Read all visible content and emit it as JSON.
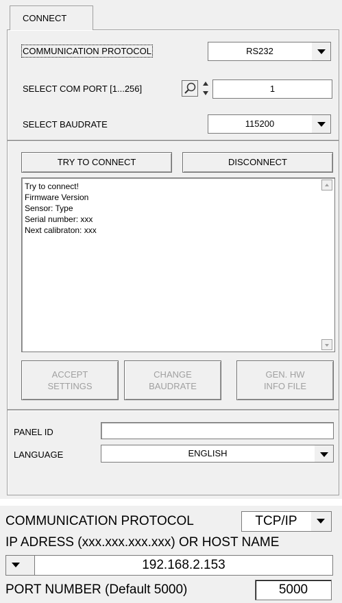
{
  "tab": {
    "label": "CONNECT"
  },
  "connection": {
    "protocol_label": "COMMUNICATION PROTOCOL",
    "protocol_value": "RS232",
    "com_port_label": "SELECT COM PORT [1...256]",
    "com_port_value": "1",
    "baudrate_label": "SELECT BAUDRATE",
    "baudrate_value": "115200"
  },
  "actions": {
    "try_connect": "TRY TO CONNECT",
    "disconnect": "DISCONNECT"
  },
  "log": [
    "Try to connect!",
    "Firmware Version",
    "Sensor: Type",
    "Serial number: xxx",
    "Next calibraton: xxx"
  ],
  "settings_buttons": {
    "accept": [
      "ACCEPT",
      "SETTINGS"
    ],
    "change_baud": [
      "CHANGE",
      "BAUDRATE"
    ],
    "gen_hw": [
      "GEN. HW",
      "INFO FILE"
    ]
  },
  "panel": {
    "id_label": "PANEL ID",
    "id_value": "",
    "language_label": "LANGUAGE",
    "language_value": "ENGLISH"
  },
  "tcp": {
    "protocol_label": "COMMUNICATION PROTOCOL",
    "protocol_value": "TCP/IP",
    "ip_label": "IP ADRESS (xxx.xxx.xxx.xxx) OR HOST NAME",
    "ip_value": "192.168.2.153",
    "port_label": "PORT NUMBER (Default 5000)",
    "port_value": "5000"
  }
}
